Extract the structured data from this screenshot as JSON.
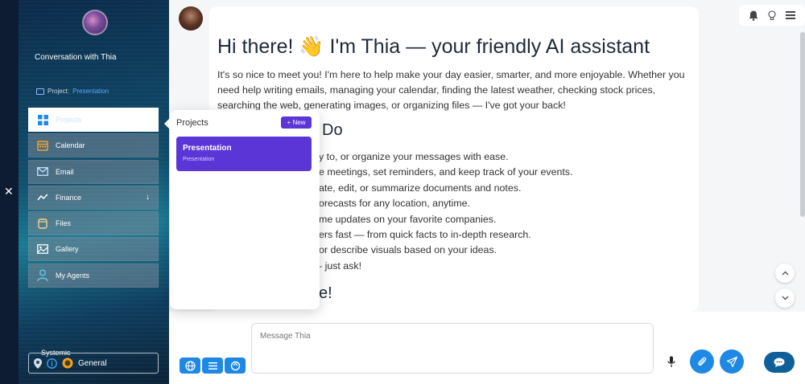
{
  "sidebar": {
    "close_glyph": "✕",
    "title": "Conversation with Thia",
    "project_prefix": "Project:",
    "project_name": "Presentation",
    "items": [
      {
        "label": "Projects",
        "icon": "grid-icon"
      },
      {
        "label": "Calendar",
        "icon": "calendar-icon"
      },
      {
        "label": "Email",
        "icon": "mail-icon"
      },
      {
        "label": "Finance",
        "icon": "chart-icon"
      },
      {
        "label": "Files",
        "icon": "file-icon"
      },
      {
        "label": "Gallery",
        "icon": "image-icon"
      },
      {
        "label": "My Agents",
        "icon": "person-icon"
      }
    ],
    "finance_arrow": "↓",
    "systemic_label": "Systemic",
    "systemic_value": "General"
  },
  "popover": {
    "title": "Projects",
    "new_label": "+ New",
    "items": [
      {
        "name": "Presentation",
        "sub": "Presentation"
      }
    ]
  },
  "message": {
    "heading": "Hi there! 👋 I'm Thia — your friendly AI assistant",
    "intro": "It's so nice to meet you! I'm here to help make your day easier, smarter, and more enjoyable. Whether you need help writing emails, managing your calendar, finding the latest weather, checking stock prices, searching the web, generating images, or organizing files — I've got your back!",
    "section_heading": "Do",
    "list": [
      "y to, or organize your messages with ease.",
      "e meetings, set reminders, and keep track of your events.",
      "ate, edit, or summarize documents and notes.",
      "orecasts for any location, anytime.",
      "me updates on your favorite companies.",
      "ers fast — from quick facts to in-depth research.",
      "or describe visuals based on your ideas.",
      "- just ask!"
    ],
    "closing_heading": "e!"
  },
  "composer": {
    "placeholder": "Message Thia"
  },
  "colors": {
    "accent": "#1e88e5",
    "purple": "#5b35d6"
  }
}
